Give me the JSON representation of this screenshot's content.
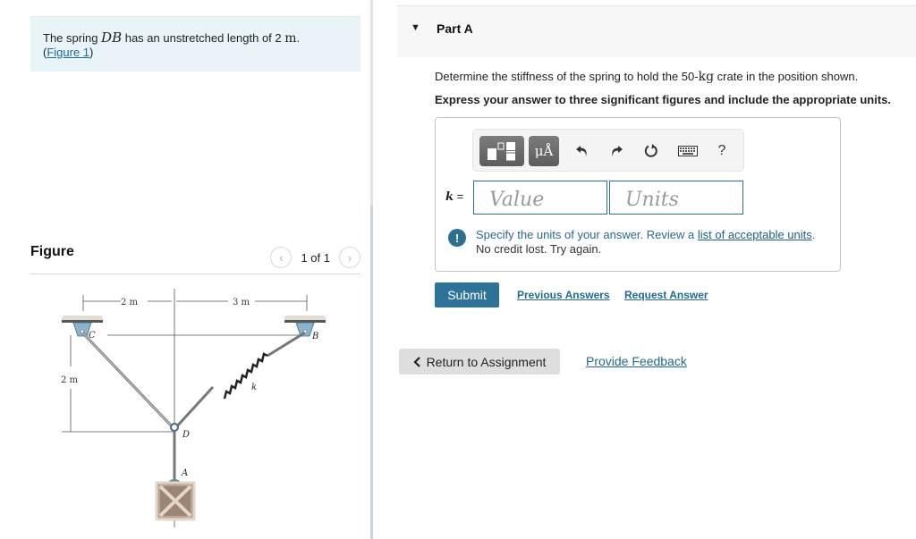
{
  "problem": {
    "intro_prefix": "The spring ",
    "intro_math": "DB",
    "intro_middle": " has an unstretched length of 2 ",
    "intro_unit": "m",
    "intro_suffix": ".",
    "figure_link_open": "(",
    "figure_link": "Figure 1",
    "figure_link_close": ")"
  },
  "figure": {
    "title": "Figure",
    "pager_text": "1 of 1",
    "prev_icon": "chevron-left-icon",
    "next_icon": "chevron-right-icon",
    "labels": {
      "dim_left": "2 m",
      "dim_right": "3 m",
      "dim_vertical": "2 m",
      "point_c": "C",
      "point_b": "B",
      "point_d": "D",
      "point_a": "A",
      "spring_k": "k"
    }
  },
  "part": {
    "caret_icon": "caret-down-icon",
    "title": "Part A",
    "question_prefix": "Determine the stiffness of the spring to hold the 50-",
    "question_unit": "kg",
    "question_suffix": " crate in the position shown.",
    "instruction": "Express your answer to three significant figures and include the appropriate units."
  },
  "toolbar": {
    "template_icon": "templates-icon",
    "units_label": "μÅ",
    "undo_icon": "undo-icon",
    "redo_icon": "redo-icon",
    "reset_icon": "reset-icon",
    "keyboard_icon": "keyboard-icon",
    "help_label": "?"
  },
  "answer": {
    "variable": "k",
    "equals": " =",
    "value_placeholder": "Value",
    "value": "",
    "units_placeholder": "Units",
    "units": ""
  },
  "feedback": {
    "icon": "!",
    "line1_prefix": "Specify the units of your answer. Review a ",
    "line1_link": "list of acceptable units",
    "line1_suffix": ".",
    "line2": "No credit lost. Try again."
  },
  "actions": {
    "submit": "Submit",
    "previous_answers": "Previous Answers",
    "request_answer": "Request Answer",
    "return_to_assignment": "Return to Assignment",
    "provide_feedback": "Provide Feedback"
  },
  "colors": {
    "accent": "#2d7397",
    "link": "#1d6a93",
    "intro_bg": "#e8f4f7"
  }
}
